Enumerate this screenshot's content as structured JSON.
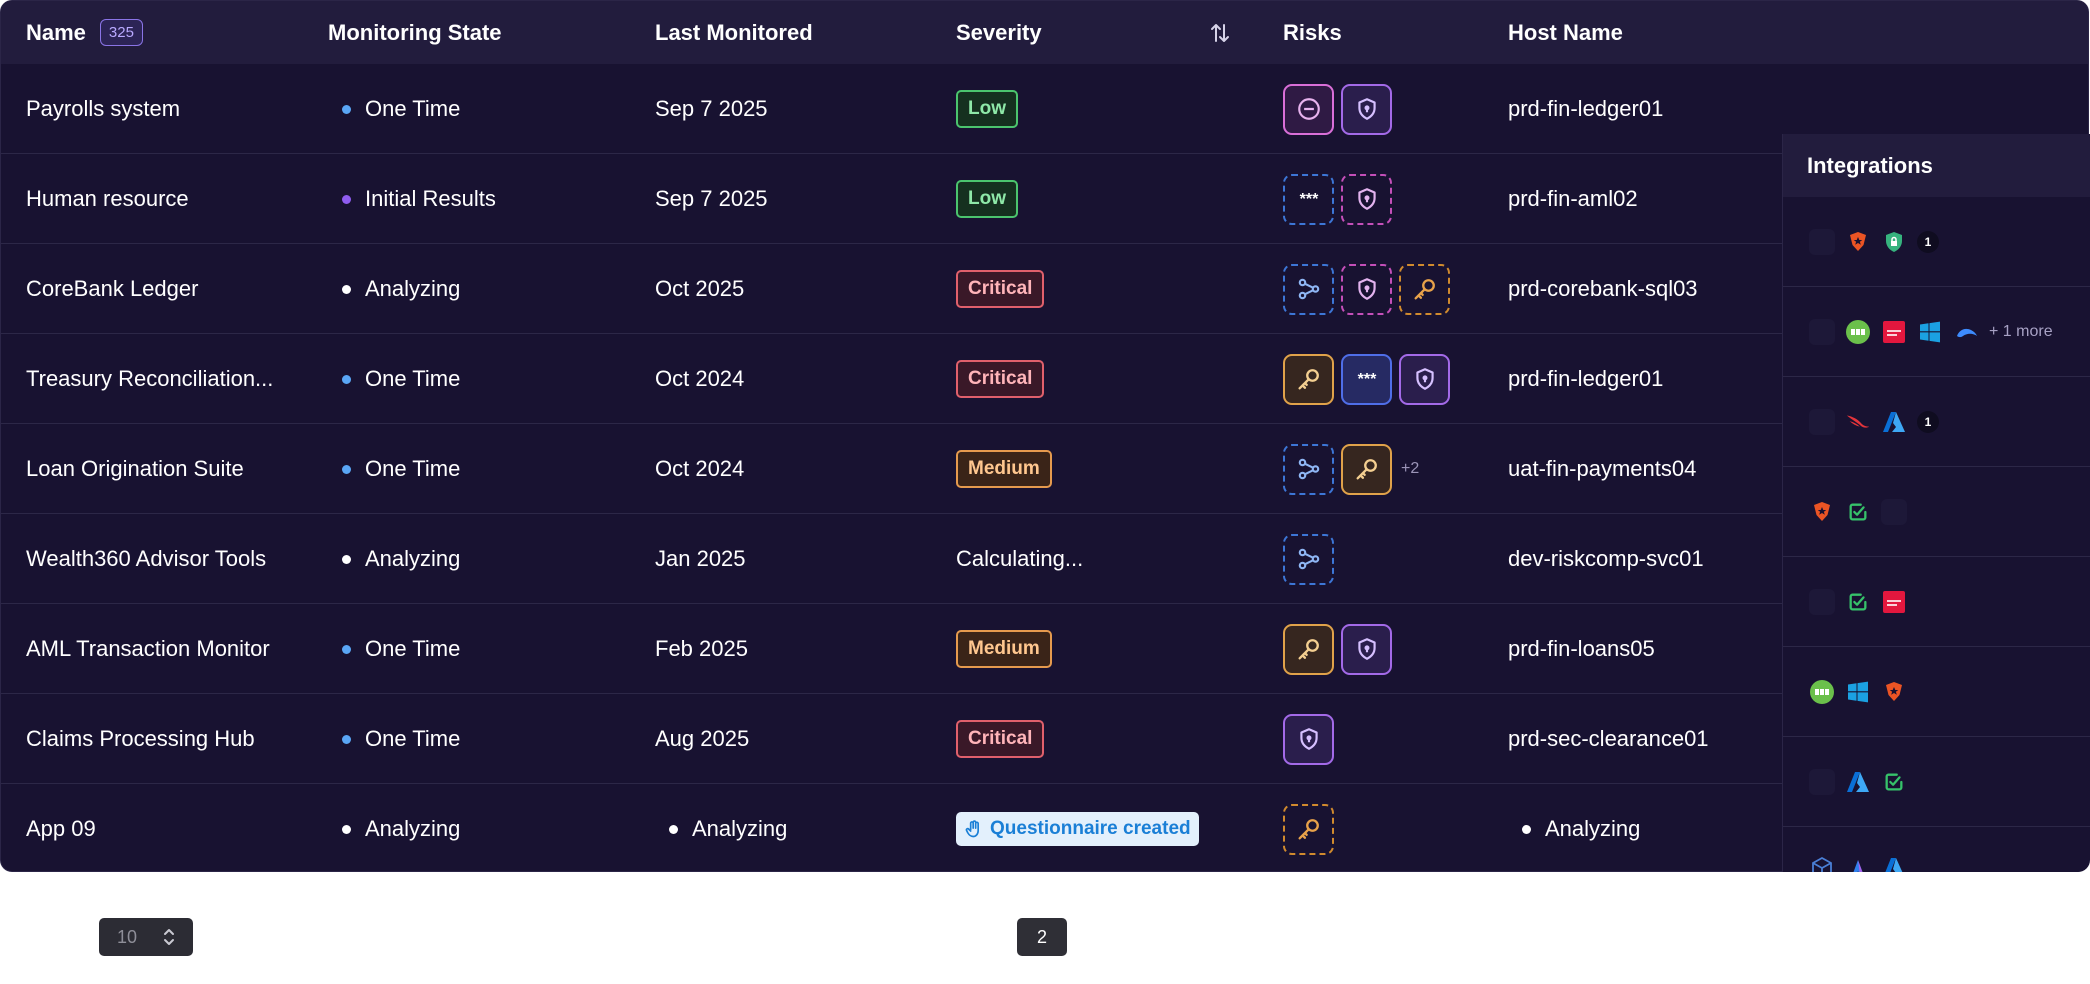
{
  "columns": {
    "name": "Name",
    "name_count": "325",
    "monitoring_state": "Monitoring State",
    "last_monitored": "Last Monitored",
    "severity": "Severity",
    "risks": "Risks",
    "host_name": "Host Name",
    "integrations": "Integrations"
  },
  "rows": [
    {
      "name": "Payrolls system",
      "state": "One Time",
      "last": "Sep 7 2025",
      "severity": "Low",
      "host": "prd-fin-ledger01"
    },
    {
      "name": "Human resource",
      "state": "Initial Results",
      "last": "Sep 7 2025",
      "severity": "Low",
      "host": "prd-fin-aml02"
    },
    {
      "name": "CoreBank Ledger",
      "state": "Analyzing",
      "last": "Oct 2025",
      "severity": "Critical",
      "host": "prd-corebank-sql03"
    },
    {
      "name": "Treasury Reconciliation...",
      "state": "One Time",
      "last": "Oct 2024",
      "severity": "Critical",
      "host": "prd-fin-ledger01"
    },
    {
      "name": "Loan Origination Suite",
      "state": "One Time",
      "last": "Oct 2024",
      "severity": "Medium",
      "host": "uat-fin-payments04",
      "risks_more": "+2"
    },
    {
      "name": "Wealth360 Advisor Tools",
      "state": "Analyzing",
      "last": "Jan 2025",
      "severity": "Calculating...",
      "host": "dev-riskcomp-svc01"
    },
    {
      "name": "AML Transaction Monitor",
      "state": "One Time",
      "last": "Feb 2025",
      "severity": "Medium",
      "host": "prd-fin-loans05"
    },
    {
      "name": "Claims Processing Hub",
      "state": "One Time",
      "last": "Aug 2025",
      "severity": "Critical",
      "host": "prd-sec-clearance01"
    },
    {
      "name": "App 09",
      "state": "Analyzing",
      "last": "Analyzing",
      "severity": "Questionnaire created",
      "host": "Analyzing"
    }
  ],
  "integrations": {
    "row2_more": "+ 1 more",
    "badge_count": "1"
  },
  "pagination": {
    "page_size": "10",
    "current_page": "2"
  },
  "colors": {
    "background": "#181231",
    "header": "#221c3d",
    "dot_one_time": "#5aa6f5",
    "dot_initial": "#8f5cf0",
    "dot_analyzing": "#ffffff"
  }
}
